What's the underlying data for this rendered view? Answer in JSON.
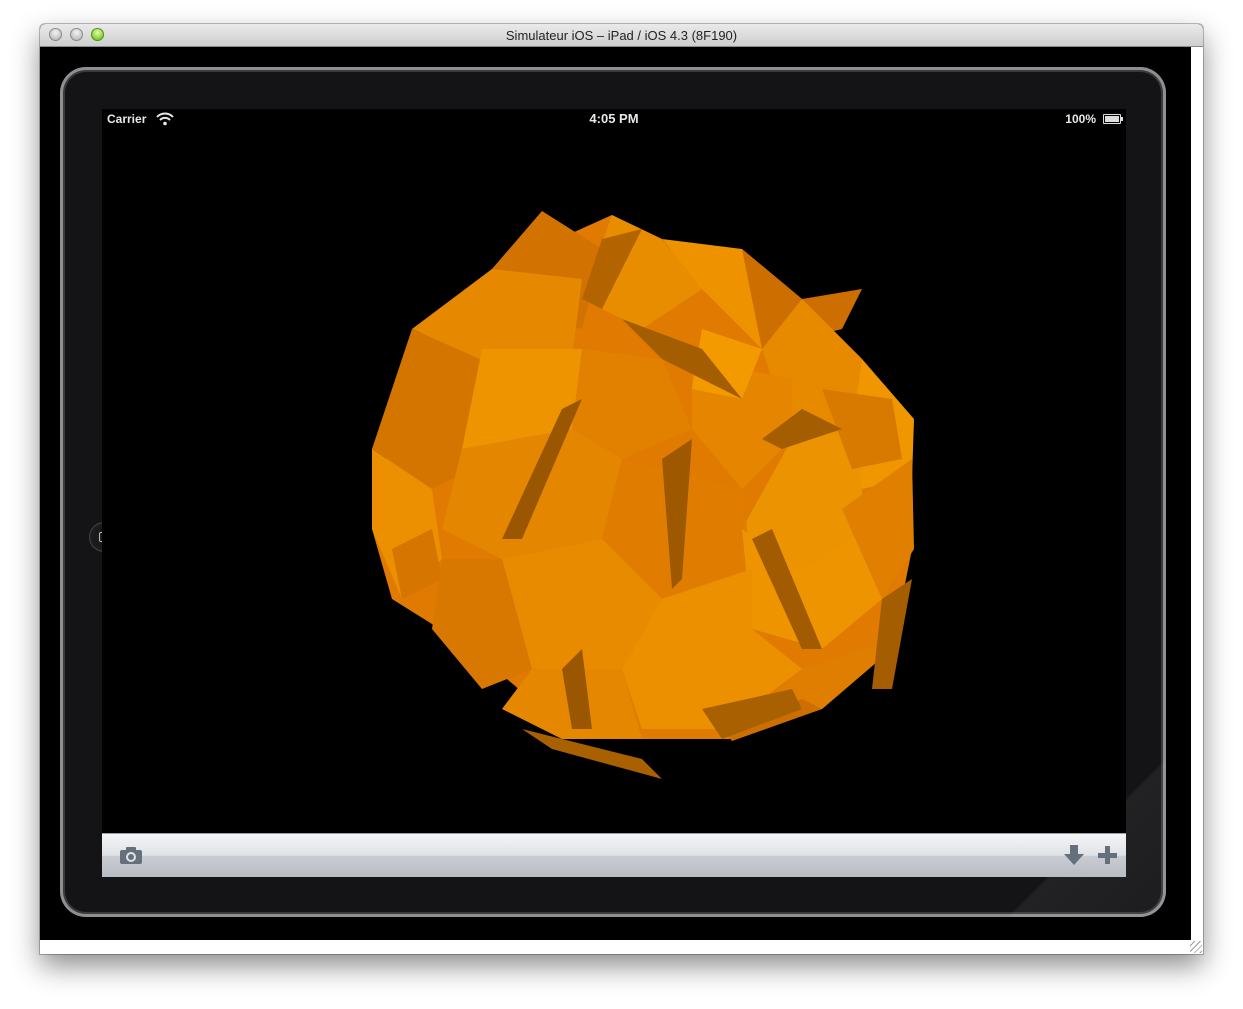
{
  "window": {
    "title": "Simulateur iOS – iPad / iOS 4.3 (8F190)"
  },
  "statusbar": {
    "carrier": "Carrier",
    "time": "4:05 PM",
    "battery": "100%"
  },
  "scene": {
    "object": "polyhedron",
    "color": "#ee9200"
  },
  "toolbar": {
    "left_icon": "camera-icon",
    "right_icons": [
      "download-arrow-icon",
      "plus-icon"
    ]
  }
}
